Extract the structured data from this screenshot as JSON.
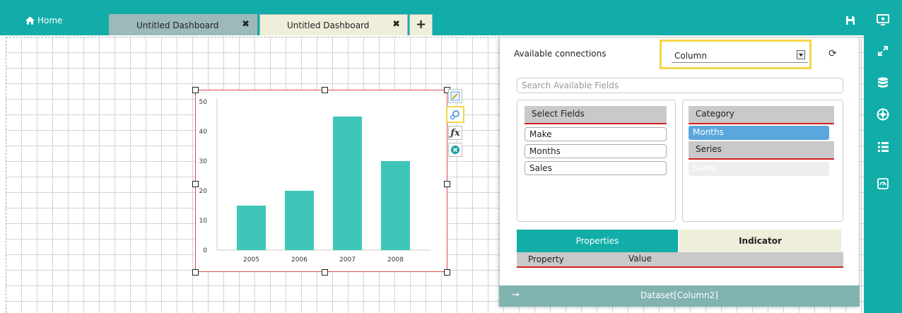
{
  "topbar": {
    "home_label": "Home",
    "tabs": [
      {
        "label": "Untitled Dashboard",
        "close": "✖"
      },
      {
        "label": "Untitled Dashboard",
        "close": "✖"
      }
    ],
    "add_tab": "+"
  },
  "panel": {
    "available_connections_label": "Available connections",
    "connection_value": "Column",
    "refresh_icon": "refresh-icon",
    "search_placeholder": "Search Available Fields",
    "select_fields_header": "Select Fields",
    "fields": [
      "Make",
      "Months",
      "Sales"
    ],
    "category_header": "Category",
    "category_items": [
      "Months"
    ],
    "series_header": "Series",
    "series_items": [
      "Sales"
    ],
    "tab_properties": "Properties",
    "tab_indicator": "Indicator",
    "col_property": "Property",
    "col_value": "Value",
    "dataset_label": "Dataset[Column2]",
    "dataset_arrow": "→"
  },
  "colors": {
    "accent": "#12ada8",
    "tab_active": "#eeeeda",
    "tab_inactive": "#9cbab9",
    "bar": "#3ec6b9",
    "highlight": "#f0d74a",
    "selected": "#5aa6dd"
  },
  "chart_data": {
    "type": "bar",
    "categories": [
      "2005",
      "2006",
      "2007",
      "2008"
    ],
    "values": [
      15,
      20,
      45,
      30
    ],
    "yticks": [
      0,
      10,
      20,
      30,
      40,
      50
    ],
    "ylim": [
      0,
      50
    ],
    "title": "",
    "xlabel": "",
    "ylabel": ""
  }
}
